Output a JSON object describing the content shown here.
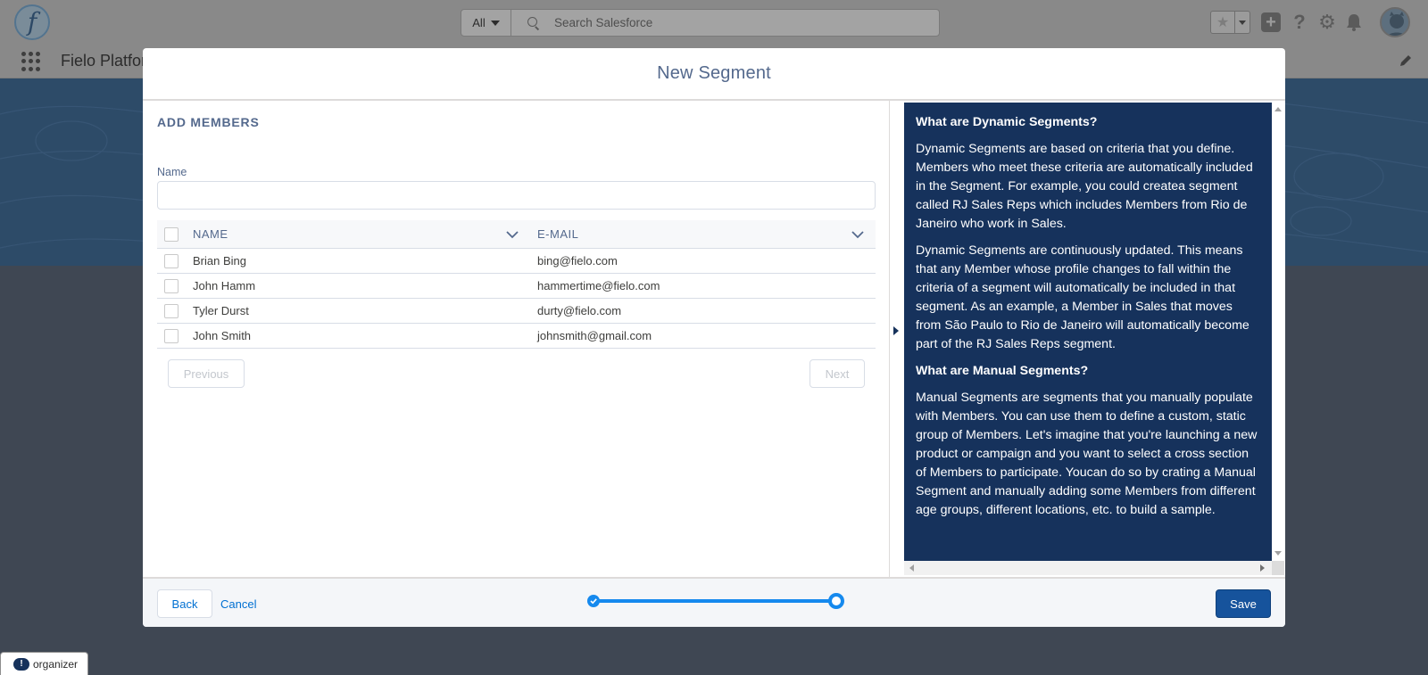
{
  "header": {
    "logo_letter": "f",
    "search_scope": "All",
    "search_placeholder": "Search Salesforce",
    "icons": [
      "favorite-star-icon",
      "add-icon",
      "help-icon",
      "gear-icon",
      "bell-icon",
      "avatar"
    ]
  },
  "nav": {
    "app_name": "Fielo Platform"
  },
  "modal": {
    "title": "New Segment",
    "section_title": "ADD MEMBERS",
    "name_label": "Name",
    "name_value": "",
    "table": {
      "columns": [
        "NAME",
        "E-MAIL"
      ],
      "rows": [
        {
          "name": "Brian Bing",
          "email": "bing@fielo.com"
        },
        {
          "name": "John Hamm",
          "email": "hammertime@fielo.com"
        },
        {
          "name": "Tyler Durst",
          "email": "durty@fielo.com"
        },
        {
          "name": "John Smith",
          "email": "johnsmith@gmail.com"
        }
      ]
    },
    "pagination": {
      "previous": "Previous",
      "next": "Next"
    },
    "help": {
      "dynamic_heading": "What are Dynamic Segments?",
      "dynamic_p1": "Dynamic Segments are based on criteria that you define. Members who meet these criteria are automatically included in the Segment. For example, you could createa segment called RJ Sales Reps which includes Members from Rio de Janeiro who work in Sales.",
      "dynamic_p2": "Dynamic Segments are continuously updated. This means that any Member whose profile changes to fall within the criteria of a segment will automatically be included in that segment. As an example, a Member in Sales that moves from São Paulo to Rio de Janeiro will automatically become part of the RJ Sales Reps segment.",
      "manual_heading": "What are Manual Segments?",
      "manual_p1": "Manual Segments are segments that you manually populate with Members. You can use them to define a custom, static group of Members. Let's imagine that you're launching a new product or campaign and you want to select a cross section of Members to participate. Youcan do so by crating a Manual Segment and manually adding some Members from different age groups, different locations, etc. to build a sample."
    },
    "footer": {
      "back": "Back",
      "cancel": "Cancel",
      "save": "Save",
      "progress_step": 2,
      "progress_total": 2
    }
  },
  "organizer": {
    "icon_text": "!",
    "label": "organizer"
  },
  "colors": {
    "brand_navy": "#16325c",
    "accent_blue": "#1589ee",
    "link_blue": "#0070d2",
    "save_button": "#16539c"
  }
}
